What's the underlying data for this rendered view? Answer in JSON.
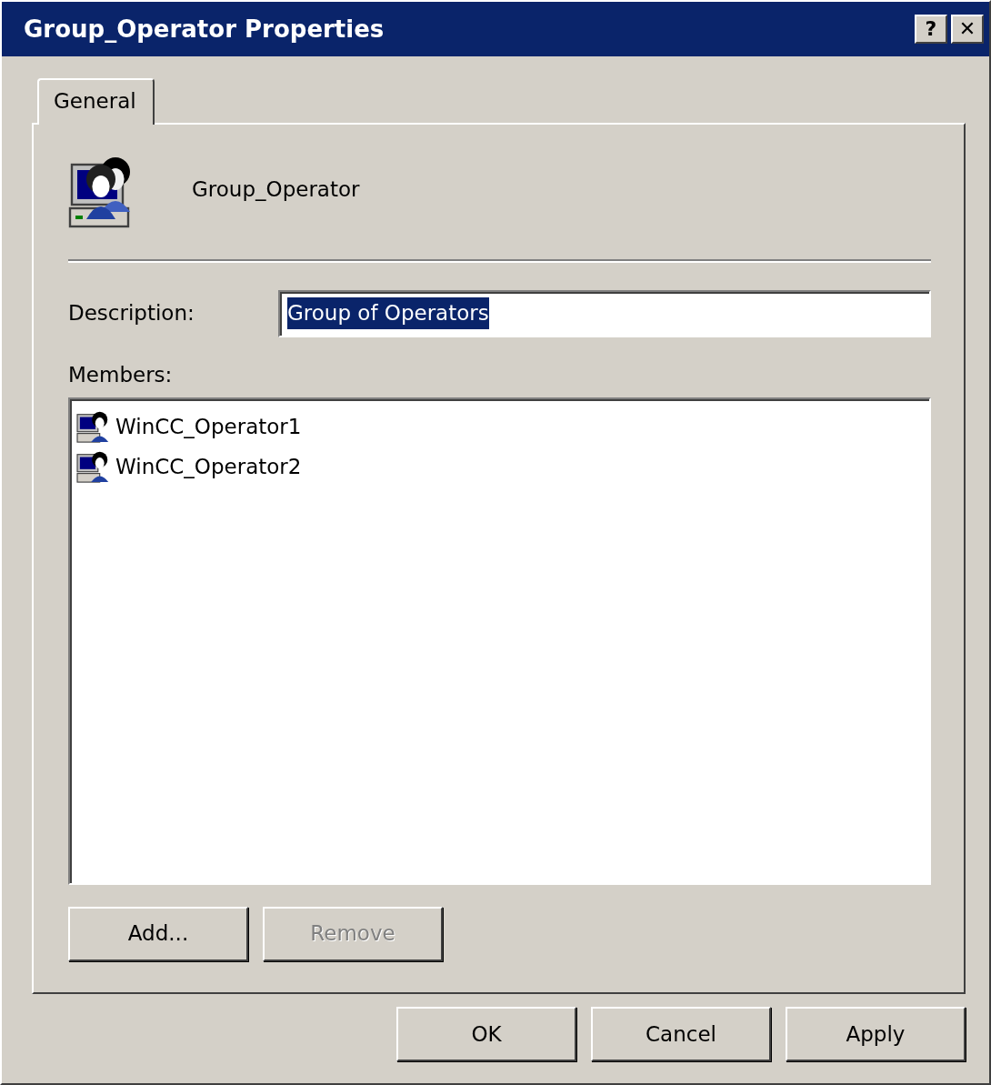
{
  "window": {
    "title": "Group_Operator Properties",
    "title_buttons": [
      "?",
      "✕"
    ]
  },
  "tabs": [
    {
      "label": "General",
      "selected": true
    }
  ],
  "header": {
    "name": "Group_Operator"
  },
  "description": {
    "label": "Description:",
    "value": "Group of Operators",
    "text_selected": true
  },
  "members": {
    "label": "Members:",
    "items": [
      {
        "name": "WinCC_Operator1"
      },
      {
        "name": "WinCC_Operator2"
      }
    ]
  },
  "member_buttons": [
    {
      "label": "Add...",
      "disabled": false
    },
    {
      "label": "Remove",
      "disabled": true
    }
  ],
  "buttons": [
    {
      "label": "OK",
      "disabled": false
    },
    {
      "label": "Cancel",
      "disabled": false
    },
    {
      "label": "Apply",
      "disabled": false
    }
  ]
}
